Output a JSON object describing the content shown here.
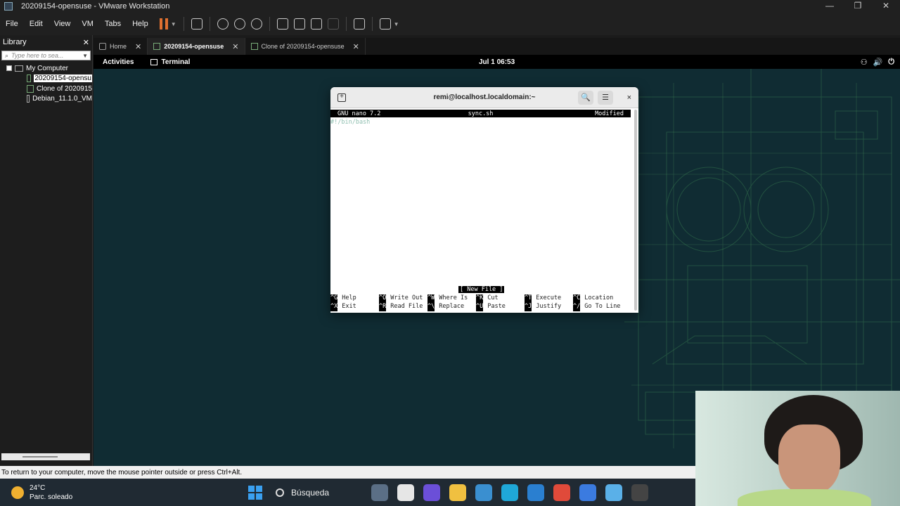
{
  "window": {
    "title": "20209154-opensuse - VMware Workstation",
    "controls": [
      "—",
      "❐",
      "✕"
    ]
  },
  "menu": [
    "File",
    "Edit",
    "View",
    "VM",
    "Tabs",
    "Help"
  ],
  "library": {
    "title": "Library",
    "close": "✕",
    "search_placeholder": "Type here to sea...",
    "root": "My Computer",
    "items": [
      "20209154-opensu",
      "Clone of 2020915",
      "Debian_11.1.0_VM"
    ]
  },
  "tabs": [
    {
      "label": "Home",
      "close": "✕"
    },
    {
      "label": "20209154-opensuse",
      "close": "✕"
    },
    {
      "label": "Clone of 20209154-opensuse",
      "close": "✕"
    }
  ],
  "gnome": {
    "activities": "Activities",
    "app": "Terminal",
    "clock": "Jul 1  06:53",
    "tray": [
      "⚇",
      "🔊",
      "⏻"
    ]
  },
  "terminal": {
    "title": "remi@localhost.localdomain:~",
    "search_icon": "🔍",
    "menu_icon": "☰",
    "close": "×",
    "nano": {
      "version": "GNU nano 7.2",
      "filename": "sync.sh",
      "state": "Modified",
      "content": "#!/bin/bash",
      "message": "[ New File ]",
      "help_rows": [
        [
          {
            "key": "^G",
            "label": "Help"
          },
          {
            "key": "^O",
            "label": "Write Out"
          },
          {
            "key": "^W",
            "label": "Where Is"
          },
          {
            "key": "^K",
            "label": "Cut"
          },
          {
            "key": "^T",
            "label": "Execute"
          },
          {
            "key": "^C",
            "label": "Location"
          }
        ],
        [
          {
            "key": "^X",
            "label": "Exit"
          },
          {
            "key": "^R",
            "label": "Read File"
          },
          {
            "key": "^\\",
            "label": "Replace"
          },
          {
            "key": "^U",
            "label": "Paste"
          },
          {
            "key": "^J",
            "label": "Justify"
          },
          {
            "key": "^/",
            "label": "Go To Line"
          }
        ]
      ]
    }
  },
  "status": "To return to your computer, move the mouse pointer outside or press Ctrl+Alt.",
  "taskbar": {
    "weather_temp": "24°C",
    "weather_desc": "Parc. soleado",
    "search_label": "Búsqueda",
    "app_colors": [
      "#5b6f86",
      "#e6e6e6",
      "#6b4fd8",
      "#f0c040",
      "#3a8fd0",
      "#1fa8d8",
      "#2a7fd0",
      "#e04a3a",
      "#3b7be0",
      "#5ab0e8",
      "#444"
    ]
  }
}
